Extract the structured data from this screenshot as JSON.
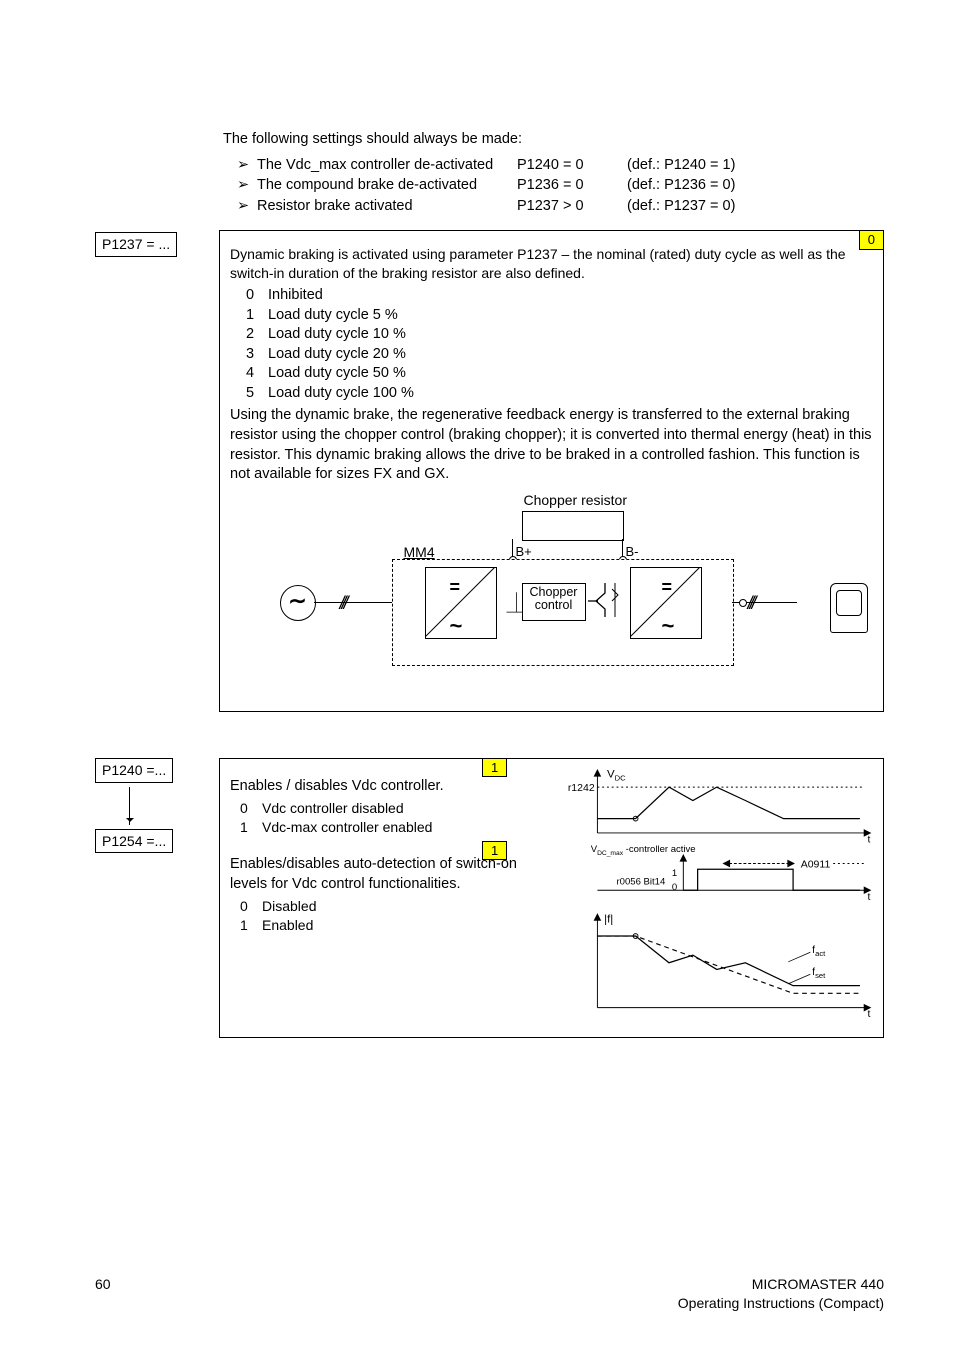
{
  "intro": "The following settings should always be made:",
  "bullets": [
    {
      "label": "The Vdc_max controller de-activated",
      "val": "P1240 = 0",
      "def": "(def.: P1240 = 1)"
    },
    {
      "label": "The compound brake de-activated",
      "val": "P1236 = 0",
      "def": "(def.: P1236 = 0)"
    },
    {
      "label": "Resistor brake activated",
      "val": "P1237 > 0",
      "def": "(def.: P1237 = 0)"
    }
  ],
  "arrow_glyph": "➢",
  "p1237": {
    "param_label": "P1237 = ...",
    "tab": "0",
    "lead": "Dynamic braking is activated using parameter P1237 – the nominal (rated) duty cycle as well as the switch-in duration of the braking resistor are also defined.",
    "options": [
      {
        "n": "0",
        "t": "Inhibited"
      },
      {
        "n": "1",
        "t": "Load duty cycle 5 %"
      },
      {
        "n": "2",
        "t": "Load duty cycle 10 %"
      },
      {
        "n": "3",
        "t": "Load duty cycle 20 %"
      },
      {
        "n": "4",
        "t": "Load duty cycle 50 %"
      },
      {
        "n": "5",
        "t": "Load duty cycle 100 %"
      }
    ],
    "trail": "Using the dynamic brake, the regenerative feedback energy is transferred to the external braking resistor using the chopper control (braking chopper); it is converted into thermal energy (heat) in this resistor. This dynamic braking allows the drive to be braked in a controlled fashion. This function is not available for sizes FX and GX.",
    "diagram": {
      "chopper_resistor": "Chopper resistor",
      "mm4": "MM4",
      "bplus": "B+",
      "bminus": "B-",
      "chopper_control_1": "Chopper",
      "chopper_control_2": "control",
      "ac_tilde": "∼",
      "eq": "=",
      "tld": "~",
      "hash": "///",
      "cap": "⏊"
    }
  },
  "p1240": {
    "param_label": "P1240 =...",
    "tab": "1",
    "lead": "Enables / disables Vdc controller.",
    "options": [
      {
        "n": "0",
        "t": "Vdc controller disabled"
      },
      {
        "n": "1",
        "t": "Vdc-max controller enabled"
      }
    ]
  },
  "p1254": {
    "param_label": "P1254 =...",
    "tab": "1",
    "lead": "Enables/disables auto-detection of switch-on levels for Vdc control functionalities.",
    "options": [
      {
        "n": "0",
        "t": "Disabled"
      },
      {
        "n": "1",
        "t": "Enabled"
      }
    ]
  },
  "chart": {
    "vdc": "V",
    "vdc_sub": "DC",
    "r1242": "r1242",
    "vdcmax_line1": "V",
    "vdcmax_sub": "DC_max",
    "vdcmax_line2": " -controller active",
    "a0911": "A0911",
    "r0056": "r0056 Bit14",
    "one": "1",
    "zero": "0",
    "f_abs": "f",
    "f_act": "f",
    "f_act_sub": "act",
    "f_set": "f",
    "f_set_sub": "set",
    "t": "t"
  },
  "footer": {
    "page": "60",
    "r1": "MICROMASTER 440",
    "r2": "Operating Instructions (Compact)"
  },
  "chart_data": {
    "type": "line",
    "panels": [
      {
        "name": "Vdc",
        "ylabel": "V_DC",
        "threshold_label": "r1242",
        "series": [
          {
            "name": "V_DC",
            "style": "solid",
            "x": [
              0,
              0.15,
              0.3,
              0.42,
              0.55,
              0.7,
              0.85,
              1.0
            ],
            "y": [
              0.35,
              0.35,
              1.0,
              0.8,
              1.0,
              0.8,
              0.35,
              0.35
            ]
          }
        ],
        "threshold_y": 1.0
      },
      {
        "name": "controller_active",
        "ylabel": "V_DC_max -controller active",
        "source": "r0056 Bit14",
        "annotation": "A0911",
        "ylim": [
          0,
          1
        ],
        "series": [
          {
            "name": "active",
            "style": "solid",
            "x": [
              0,
              0.3,
              0.3,
              0.8,
              0.8,
              1.0
            ],
            "y": [
              0,
              0,
              1,
              1,
              0,
              0
            ]
          }
        ]
      },
      {
        "name": "frequency",
        "ylabel": "|f|",
        "series": [
          {
            "name": "f_act",
            "style": "solid",
            "x": [
              0,
              0.15,
              0.3,
              0.42,
              0.55,
              0.7,
              0.85,
              1.0
            ],
            "y": [
              1.0,
              1.0,
              0.62,
              0.72,
              0.55,
              0.65,
              0.3,
              0.3
            ]
          },
          {
            "name": "f_set",
            "style": "dashed",
            "x": [
              0,
              0.15,
              0.85,
              1.0
            ],
            "y": [
              1.0,
              1.0,
              0.2,
              0.2
            ]
          }
        ]
      }
    ],
    "xlabel": "t"
  }
}
